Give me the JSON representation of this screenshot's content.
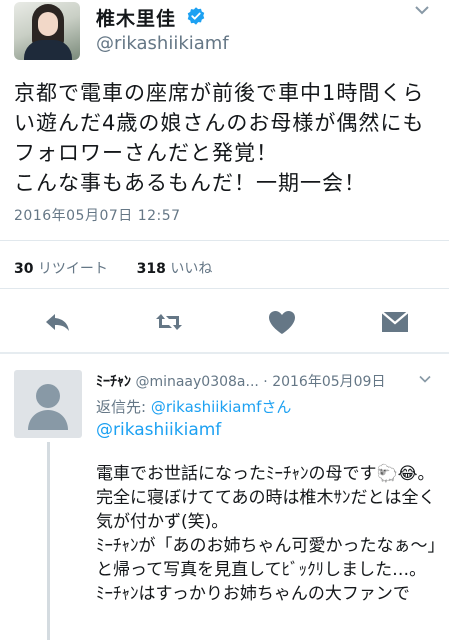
{
  "tweet": {
    "display_name": "椎木里佳",
    "handle": "@rikashiikiamf",
    "text": "京都で電車の座席が前後で車中1時間くらい遊んだ4歳の娘さんのお母様が偶然にもフォロワーさんだと発覚！\nこんな事もあるもんだ！一期一会！",
    "timestamp": "2016年05月07日 12:57",
    "retweets_count": "30",
    "retweets_label": "リツイート",
    "likes_count": "318",
    "likes_label": "いいね"
  },
  "reply": {
    "name": "ﾐｰﾁｬﾝ",
    "meta": "@minaay0308a... · 2016年05月09日",
    "reply_to_prefix": "返信先:",
    "reply_to_link": "@rikashiikiamfさん",
    "mention": "@rikashiikiamf",
    "text": "電車でお世話になったﾐｰﾁｬﾝの母です🐑😂。\n完全に寝ぼけててあの時は椎木ｻﾝだとは全く気が付かず(笑)。\nﾐｰﾁｬﾝが「あのお姉ちゃん可愛かったなぁ〜」と帰って写真を見直してﾋﾞｯｸﾘしました…。\nﾐｰﾁｬﾝはすっかりお姉ちゃんの大ファンで"
  },
  "icons": [
    "verified-badge-icon",
    "chevron-down-icon",
    "reply-icon",
    "retweet-icon",
    "like-heart-icon",
    "direct-message-icon",
    "default-avatar-icon"
  ],
  "colors": {
    "accent": "#1da1f2",
    "action_gray": "#657786",
    "text": "#14171a"
  }
}
